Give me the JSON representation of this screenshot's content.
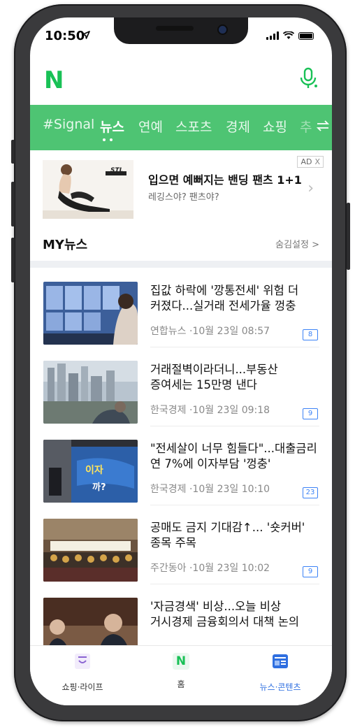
{
  "status": {
    "time": "10:50"
  },
  "app": {
    "logo": "N"
  },
  "nav": {
    "tabs": [
      {
        "label": "#Signal",
        "active": false
      },
      {
        "label": "뉴스",
        "active": true
      },
      {
        "label": "연예",
        "active": false
      },
      {
        "label": "스포츠",
        "active": false
      },
      {
        "label": "경제",
        "active": false
      },
      {
        "label": "쇼핑",
        "active": false
      },
      {
        "label": "추",
        "active": false
      }
    ],
    "more_icon": "swap-arrows-icon"
  },
  "ad": {
    "badge": "AD",
    "close": "X",
    "brand": "STL",
    "title": "입으면 예뻐지는 밴딩 팬츠 1+1",
    "subtitle": "레깅스야? 팬츠야?"
  },
  "mynews": {
    "title": "MY뉴스",
    "setting": "숨김설정 >"
  },
  "news": [
    {
      "title": "집값 하락에 '깡통전세' 위험 더 커졌다...실거래 전세가율 껑충",
      "meta": "연합뉴스 ·10월 23일 08:57",
      "count": "8"
    },
    {
      "title": "거래절벽이라더니...부동산 증여세는 15만명 낸다",
      "meta": "한국경제 ·10월 23일 09:18",
      "count": "9"
    },
    {
      "title": "\"전세살이 너무 힘들다\"...대출금리 연 7%에 이자부담 '껑충'",
      "meta": "한국경제 ·10월 23일 10:10",
      "count": "23"
    },
    {
      "title": "공매도 금지 기대감↑... '숏커버' 종목 주목",
      "meta": "주간동아 ·10월 23일 10:02",
      "count": "9"
    },
    {
      "title": "'자금경색' 비상...오늘 비상 거시경제 금융회의서 대책 논의",
      "meta": "",
      "count": ""
    }
  ],
  "tabbar": {
    "tabs": [
      {
        "label": "쇼핑·라이프",
        "active": false
      },
      {
        "label": "홈",
        "active": false,
        "icon_text": "N"
      },
      {
        "label": "뉴스·콘텐츠",
        "active": true
      }
    ]
  },
  "colors": {
    "brand_green": "#19c156",
    "nav_green": "#4ec473",
    "accent_blue": "#2f6fe0"
  }
}
